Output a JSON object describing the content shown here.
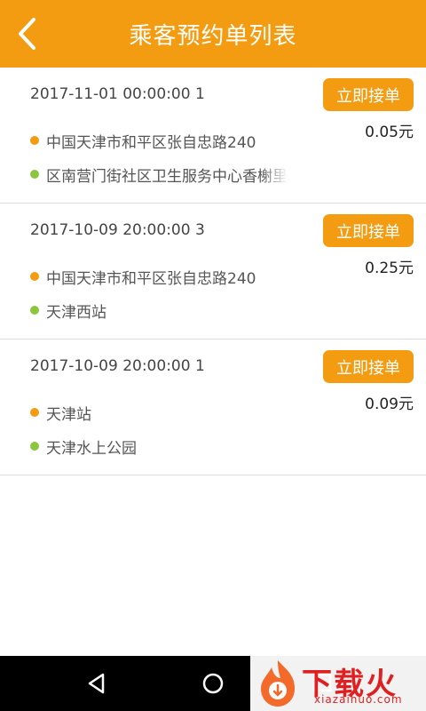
{
  "header": {
    "title": "乘客预约单列表"
  },
  "orders": [
    {
      "meta": "2017-11-01 00:00:00 1",
      "button": "立即接单",
      "price": "0.05元",
      "from": "中国天津市和平区张自忠路240",
      "to": "区南营门街社区卫生服务中心香榭里"
    },
    {
      "meta": "2017-10-09 20:00:00 3",
      "button": "立即接单",
      "price": "0.25元",
      "from": "中国天津市和平区张自忠路240",
      "to": "天津西站"
    },
    {
      "meta": "2017-10-09 20:00:00 1",
      "button": "立即接单",
      "price": "0.09元",
      "from": "天津站",
      "to": "天津水上公园"
    }
  ],
  "watermark": {
    "text": "下载火",
    "sub": "xiazaihuo.com"
  },
  "colors": {
    "accent": "#f39c12",
    "from_dot": "#f39c12",
    "to_dot": "#8cc63f"
  }
}
